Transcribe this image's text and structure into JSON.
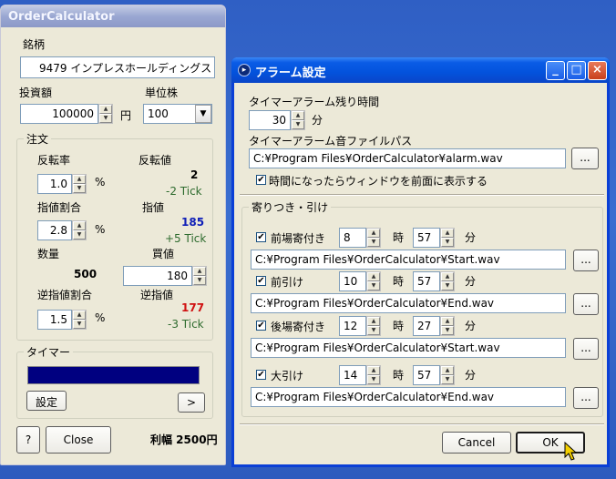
{
  "calc": {
    "title": "OrderCalculator",
    "stock_label": "銘柄",
    "stock_value": "9479 インプレスホールディングス",
    "investment_label": "投資額",
    "investment_value": "100000",
    "yen_unit": "円",
    "unit_label": "単位株",
    "unit_value": "100",
    "order_group": "注文",
    "reversal_rate_label": "反転率",
    "reversal_rate_value": "1.0",
    "percent": "%",
    "reversal_value_label": "反転値",
    "reversal_value": "2",
    "reversal_tick": "-2 Tick",
    "limit_ratio_label": "指値割合",
    "limit_ratio_value": "2.8",
    "limit_label": "指値",
    "limit_value": "185",
    "limit_tick": "+5 Tick",
    "quantity_label": "数量",
    "quantity_value": "500",
    "buy_label": "買値",
    "buy_value": "180",
    "stop_ratio_label": "逆指値割合",
    "stop_ratio_value": "1.5",
    "stop_label": "逆指値",
    "stop_value": "177",
    "stop_tick": "-3 Tick",
    "timer_group": "タイマー",
    "timer_progress": 1.0,
    "settings_button": "設定",
    "next_button": ">",
    "help_button": "?",
    "close_button": "Close",
    "profit_text": "利幅 2500円"
  },
  "dialog": {
    "title": "アラーム設定",
    "remaining_label": "タイマーアラーム残り時間",
    "remaining_value": "30",
    "minute_unit": "分",
    "sound_path_label": "タイマーアラーム音ファイルパス",
    "sound_path_value": "C:¥Program Files¥OrderCalculator¥alarm.wav",
    "browse_label": "...",
    "front_checkbox_label": "時間になったらウィンドウを前面に表示する",
    "front_checked": true,
    "session_group": "寄りつき・引け",
    "hour_unit": "時",
    "sessions": [
      {
        "label": "前場寄付き",
        "checked": true,
        "hour": "8",
        "minute": "57",
        "path": "C:¥Program Files¥OrderCalculator¥Start.wav"
      },
      {
        "label": "前引け",
        "checked": true,
        "hour": "10",
        "minute": "57",
        "path": "C:¥Program Files¥OrderCalculator¥End.wav"
      },
      {
        "label": "後場寄付き",
        "checked": true,
        "hour": "12",
        "minute": "27",
        "path": "C:¥Program Files¥OrderCalculator¥Start.wav"
      },
      {
        "label": "大引け",
        "checked": true,
        "hour": "14",
        "minute": "57",
        "path": "C:¥Program Files¥OrderCalculator¥End.wav"
      }
    ],
    "cancel_button": "Cancel",
    "ok_button": "OK"
  },
  "colors": {
    "desktop": "#3a6ed0",
    "dialog_titlebar": "#0352dc",
    "timer_bar": "#000080",
    "limit_value": "#1020b8",
    "stop_value": "#d01010",
    "tick_text": "#2e6b2e"
  }
}
